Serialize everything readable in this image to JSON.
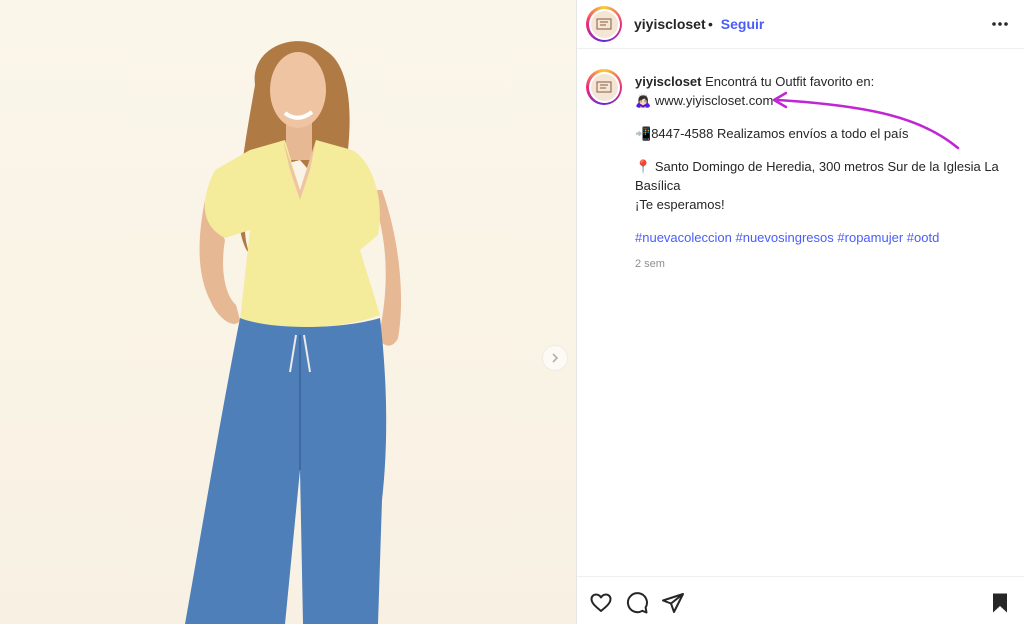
{
  "post": {
    "username": "yiyiscloset",
    "follow_separator": "•",
    "follow_label": "Seguir",
    "avatar_text": "yiyis closet"
  },
  "caption": {
    "username": "yiyiscloset",
    "line1": "Encontrá tu Outfit favorito en:",
    "website_emoji": "🙇🏻‍♀️",
    "website": "www.yiyiscloset.com",
    "phone_emoji": "📲",
    "phone_line": "8447-4588 Realizamos envíos a todo el país",
    "location_emoji": "📍",
    "location_line": "Santo Domingo de Heredia, 300 metros Sur de la Iglesia La Basílica",
    "closing": "¡Te esperamos!",
    "hashtags": [
      "#nuevacoleccion",
      "#nuevosingresos",
      "#ropamujer",
      "#ootd"
    ],
    "time": "2 sem"
  },
  "icons": {
    "more": "more-options-icon",
    "next": "chevron-right-icon",
    "like": "heart-icon",
    "comment": "comment-icon",
    "share": "send-icon",
    "save": "bookmark-icon"
  },
  "colors": {
    "link_blue": "#4a5df9",
    "annotation_arrow": "#c026d3",
    "text": "#262626",
    "muted": "#8e8e8e"
  }
}
